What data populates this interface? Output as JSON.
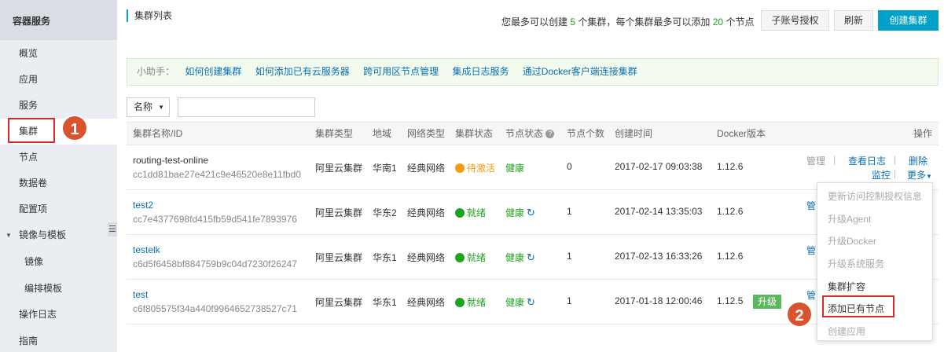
{
  "sidebar": {
    "title": "容器服务",
    "items": [
      {
        "label": "概览"
      },
      {
        "label": "应用"
      },
      {
        "label": "服务"
      },
      {
        "label": "集群"
      },
      {
        "label": "节点"
      },
      {
        "label": "数据卷"
      },
      {
        "label": "配置项"
      },
      {
        "label": "镜像与模板"
      },
      {
        "label": "镜像"
      },
      {
        "label": "编排模板"
      },
      {
        "label": "操作日志"
      },
      {
        "label": "指南"
      }
    ],
    "collapse_glyph": "☰"
  },
  "annotations": {
    "step1": "1",
    "step2": "2"
  },
  "header": {
    "title": "集群列表",
    "quota_pre": "您最多可以创建",
    "quota_clusters": "5",
    "quota_mid": "个集群，每个集群最多可以添加",
    "quota_nodes": "20",
    "quota_post": "个节点",
    "btn_sub_account": "子账号授权",
    "btn_refresh": "刷新",
    "btn_create": "创建集群"
  },
  "helper": {
    "label": "小助手：",
    "links": [
      "如何创建集群",
      "如何添加已有云服务器",
      "跨可用区节点管理",
      "集成日志服务",
      "通过Docker客户端连接集群"
    ]
  },
  "filter": {
    "select_value": "名称",
    "input_value": ""
  },
  "table": {
    "headers": {
      "name": "集群名称/ID",
      "type": "集群类型",
      "region": "地域",
      "network": "网络类型",
      "status": "集群状态",
      "node_status": "节点状态",
      "node_count": "节点个数",
      "created": "创建时间",
      "docker": "Docker版本",
      "actions": "操作"
    },
    "rows": [
      {
        "name": "routing-test-online",
        "id": "cc1dd81bae27e421c9e46520e8e11fbd0",
        "type": "阿里云集群",
        "region": "华南1",
        "network": "经典网络",
        "status": "待激活",
        "node_status": "健康",
        "count": "0",
        "created": "2017-02-17 09:03:38",
        "docker": "1.12.6"
      },
      {
        "name": "test2",
        "id": "cc7e4377698fd415fb59d541fe7893976",
        "type": "阿里云集群",
        "region": "华东2",
        "network": "经典网络",
        "status": "就绪",
        "node_status": "健康",
        "count": "1",
        "created": "2017-02-14 13:35:03",
        "docker": "1.12.6",
        "op_cut": "管"
      },
      {
        "name": "testelk",
        "id": "c6d5f6458bf884759b9c04d7230f26247",
        "type": "阿里云集群",
        "region": "华东1",
        "network": "经典网络",
        "status": "就绪",
        "node_status": "健康",
        "count": "1",
        "created": "2017-02-13 16:33:26",
        "docker": "1.12.6",
        "op_cut": "管"
      },
      {
        "name": "test",
        "id": "c6f805575f34a440f9964652738527c71",
        "type": "阿里云集群",
        "region": "华东1",
        "network": "经典网络",
        "status": "就绪",
        "node_status": "健康",
        "count": "1",
        "created": "2017-01-18 12:00:46",
        "docker": "1.12.5",
        "upgrade": "升级",
        "op_cut": "管"
      }
    ],
    "row1_actions": {
      "manage": "管理",
      "logs": "查看日志",
      "delete": "删除",
      "monitor": "监控",
      "more": "更多",
      "sep": "|"
    }
  },
  "dropdown": {
    "items": [
      "更新访问控制授权信息",
      "升级Agent",
      "升级Docker",
      "升级系统服务",
      "集群扩容",
      "添加已有节点",
      "创建应用"
    ]
  },
  "icons": {
    "refresh": "↻",
    "caret_down": "▼",
    "help": "?"
  },
  "colors": {
    "accent": "#00a2ca",
    "link": "#0a6fb3",
    "ok": "#1fa31f",
    "pending": "#f39c12",
    "highlight": "#d9282a",
    "badge": "#d9542c"
  }
}
